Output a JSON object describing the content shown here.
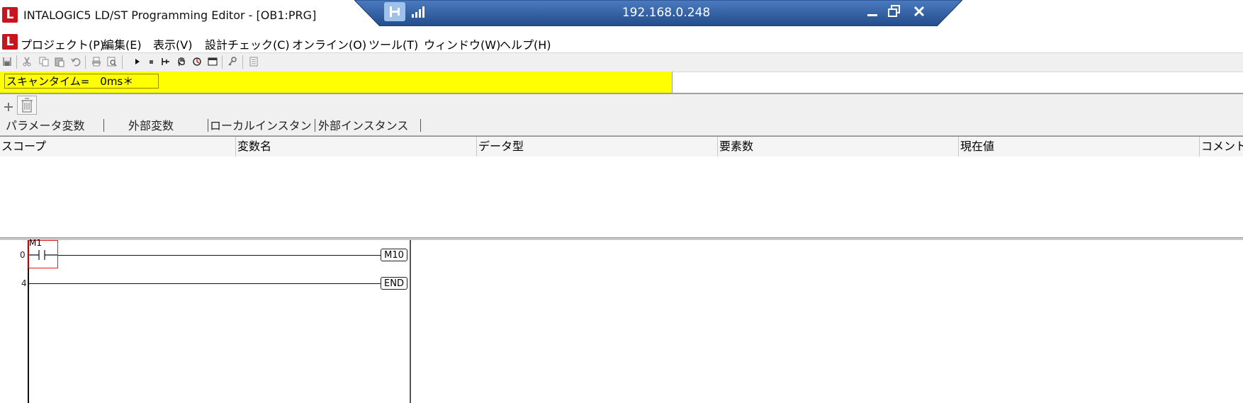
{
  "window": {
    "title": "INTALOGIC5 LD/ST Programming Editor - [OB1:PRG]",
    "logo_letter": "L",
    "accent": "#c8141c"
  },
  "remote": {
    "ip": "192.168.0.248",
    "icons": [
      "pin-icon",
      "signal-icon",
      "minimize-icon",
      "restore-icon",
      "close-icon"
    ],
    "bar_color": "#2f5f9e"
  },
  "menu": {
    "logo_letter": "L",
    "items": [
      "プロジェクト(P)",
      "編集(E)",
      "表示(V)",
      "設計チェック(C)",
      "オンライン(O)",
      "ツール(T)",
      "ウィンドウ(W)",
      "ヘルプ(H)"
    ]
  },
  "toolbar": {
    "icons": [
      "save-icon",
      "cut-icon",
      "copy-icon",
      "paste-icon",
      "undo-icon",
      "print-icon",
      "print-preview-icon",
      "run-icon",
      "stop-icon",
      "step-icon",
      "hand-icon",
      "monitor-icon",
      "window-icon",
      "key-icon",
      "list-icon"
    ]
  },
  "scan": {
    "text": "スキャンタイム=　0ms＊",
    "color": "#ffff00"
  },
  "variables": {
    "tabs": [
      "パラメータ変数",
      "外部変数",
      "ローカルインスタン",
      "外部インスタンス"
    ],
    "columns": [
      "スコープ",
      "変数名",
      "データ型",
      "要素数",
      "現在値",
      "コメント"
    ]
  },
  "ladder": {
    "rungs": [
      {
        "number": "0",
        "contact": "M1",
        "coil": "M10"
      },
      {
        "number": "4",
        "contact": "",
        "coil": "END"
      }
    ],
    "selection_color": "#e02020"
  }
}
